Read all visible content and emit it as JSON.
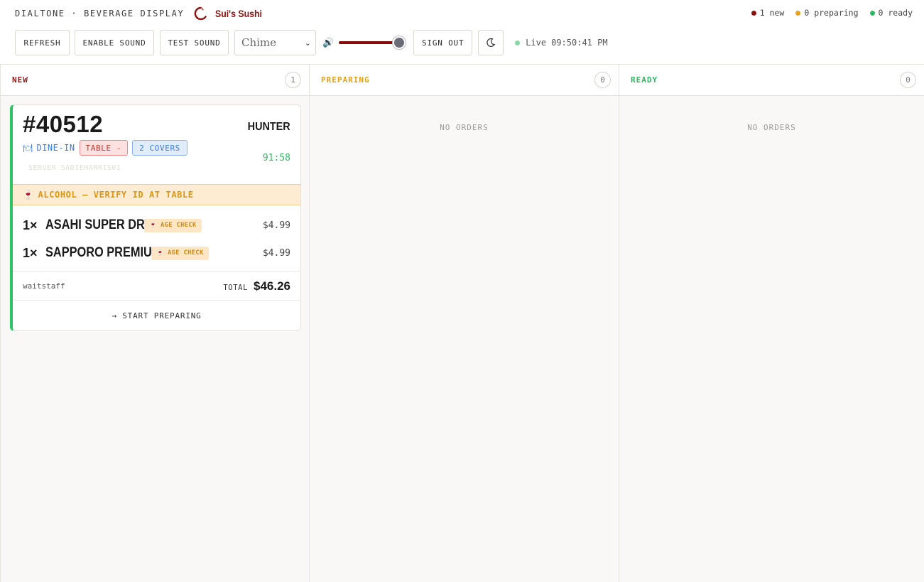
{
  "header": {
    "app_name": "DIALTONE · BEVERAGE DISPLAY",
    "restaurant_name": "Sui's Sushi",
    "summary": {
      "new_label": "1 new",
      "preparing_label": "0 preparing",
      "ready_label": "0 ready"
    }
  },
  "toolbar": {
    "refresh_label": "REFRESH",
    "enable_sound_label": "ENABLE SOUND",
    "test_sound_label": "TEST SOUND",
    "sound_select_value": "Chime",
    "volume_level": 0.95,
    "sign_out_label": "SIGN OUT",
    "live_label": "Live",
    "live_time": "09:50:41 PM"
  },
  "columns": [
    {
      "title": "NEW",
      "count": "1",
      "color": "#8b1a1a"
    },
    {
      "title": "PREPARING",
      "count": "0",
      "color": "#e0a020",
      "empty_text": "NO ORDERS"
    },
    {
      "title": "READY",
      "count": "0",
      "color": "#2fb862",
      "empty_text": "NO ORDERS"
    }
  ],
  "order": {
    "number": "#40512",
    "customer": "HUNTER",
    "type_label": "DINE-IN",
    "table_label": "TABLE -",
    "covers_label": "2 COVERS",
    "timer": "91:58",
    "server": "SERVER SADIEHARRIS01",
    "alert": "ALCOHOL — VERIFY ID AT TABLE",
    "items": [
      {
        "qty": "1×",
        "name": "ASAHI SUPER DRY",
        "badge": "AGE CHECK",
        "price": "$4.99"
      },
      {
        "qty": "1×",
        "name": "SAPPORO PREMIUM",
        "badge": "AGE CHECK",
        "price": "$4.99"
      }
    ],
    "source": "waitstaff",
    "total_label": "TOTAL",
    "total_value": "$46.26",
    "action_label": "→ START PREPARING"
  },
  "colors": {
    "brand": "#8b1010",
    "accent_green": "#2fc267",
    "volume_track": "#8b0b0b",
    "alert_bg": "#fdecd2",
    "dine_blue": "#3d7cd6"
  },
  "icons": {
    "brand": "brand-swirl-icon",
    "speaker": "speaker-icon",
    "theme": "moon-icon",
    "dine_in": "plate-icon",
    "alcohol": "wine-glass-icon"
  }
}
